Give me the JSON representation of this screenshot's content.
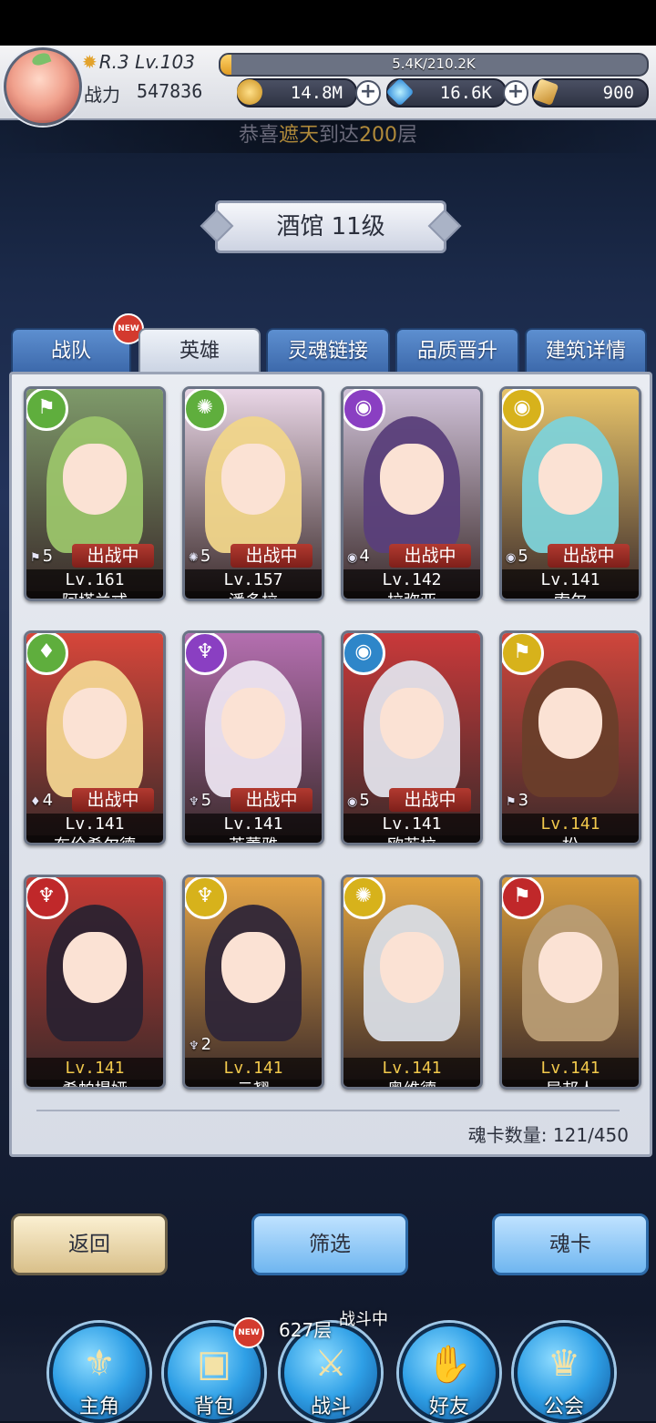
{
  "header": {
    "rank": "R.3 Lv.103",
    "exp_text": "5.4K/210.2K",
    "exp_fraction": 0.026,
    "power_label": "战力",
    "power_value": "547836",
    "gold": "14.8M",
    "diamond": "16.6K",
    "tickets": "900"
  },
  "announcement": {
    "prefix": "恭喜",
    "name": "遮天",
    "middle": "到达",
    "floor": "200",
    "suffix": "层"
  },
  "banner": {
    "title": "酒馆 11级"
  },
  "tabs": [
    {
      "label": "战队",
      "new": true,
      "new_label": "NEW"
    },
    {
      "label": "英雄",
      "active": true
    },
    {
      "label": "灵魂链接"
    },
    {
      "label": "品质晋升"
    },
    {
      "label": "建筑详情"
    }
  ],
  "heroes": [
    {
      "name": "阿塔兰忒",
      "level": "Lv.161",
      "stars": "5",
      "fighting": "出战中",
      "element": "flag",
      "icon": "flag-icon",
      "elem_color": "#5fae3d",
      "hair": "#9bc46a",
      "bg": "#7e9a6a"
    },
    {
      "name": "潘多拉",
      "level": "Lv.157",
      "stars": "5",
      "fighting": "出战中",
      "element": "swirl",
      "icon": "swirl-icon",
      "elem_color": "#5fae3d",
      "hair": "#f0d58a",
      "bg": "#e9d6e6"
    },
    {
      "name": "拉弥亚",
      "level": "Lv.142",
      "stars": "4",
      "fighting": "出战中",
      "element": "eye",
      "icon": "eye-icon",
      "elem_color": "#8a3fc2",
      "hair": "#5a3f7a",
      "bg": "#d0c2d8"
    },
    {
      "name": "索尔",
      "level": "Lv.141",
      "stars": "5",
      "fighting": "出战中",
      "element": "eye",
      "icon": "eye-icon",
      "elem_color": "#d7b21b",
      "hair": "#7ed2d8",
      "bg": "#e8c46a"
    },
    {
      "name": "布伦希尔德",
      "level": "Lv.141",
      "stars": "4",
      "fighting": "出战中",
      "element": "blade",
      "icon": "blade-icon",
      "elem_color": "#5fae3d",
      "hair": "#f2d490",
      "bg": "#d7463a"
    },
    {
      "name": "芙蕾雅",
      "level": "Lv.141",
      "stars": "5",
      "fighting": "出战中",
      "element": "wing",
      "icon": "wing-icon",
      "elem_color": "#8a3fc2",
      "hair": "#ece4f0",
      "bg": "#b46fb0"
    },
    {
      "name": "欧若拉",
      "level": "Lv.141",
      "stars": "5",
      "fighting": "出战中",
      "element": "eye",
      "icon": "eye-icon",
      "elem_color": "#2e86c9",
      "hair": "#e2e2ea",
      "bg": "#c9393a"
    },
    {
      "name": "松",
      "level": "Lv.141",
      "stars": "3",
      "fighting": "",
      "element": "flag",
      "icon": "flag-icon",
      "elem_color": "#d7b21b",
      "hair": "#6a3e2a",
      "bg": "#d0463c",
      "gold_level": true
    },
    {
      "name": "希帕提娅",
      "level": "Lv.141",
      "stars": "",
      "fighting": "",
      "element": "wing",
      "icon": "wing-icon",
      "elem_color": "#c0282a",
      "hair": "#2b2230",
      "bg": "#c43a34",
      "gold_level": true
    },
    {
      "name": "云翘",
      "level": "Lv.141",
      "stars": "2",
      "fighting": "",
      "element": "wing",
      "icon": "wing-icon",
      "elem_color": "#d7b21b",
      "hair": "#2f2638",
      "bg": "#e4a446",
      "gold_level": true
    },
    {
      "name": "奥维德",
      "level": "Lv.141",
      "stars": "",
      "fighting": "",
      "element": "swirl",
      "icon": "swirl-icon",
      "elem_color": "#d7b21b",
      "hair": "#d8dce4",
      "bg": "#e2a440",
      "gold_level": true
    },
    {
      "name": "异邦人",
      "level": "Lv.141",
      "stars": "",
      "fighting": "",
      "element": "flag",
      "icon": "flag-icon",
      "elem_color": "#c0282a",
      "hair": "#b89c74",
      "bg": "#d69a3a",
      "gold_level": true
    }
  ],
  "card_count_label": "魂卡数量",
  "card_count_value": "121/450",
  "buttons": {
    "back": "返回",
    "filter": "筛选",
    "soul_card": "魂卡"
  },
  "bottom_status": {
    "floor": "627层",
    "status": "战斗中"
  },
  "nav": [
    {
      "label": "主角",
      "icon": "helmet-icon",
      "glyph": "⚜"
    },
    {
      "label": "背包",
      "icon": "backpack-icon",
      "glyph": "▣",
      "new": true,
      "new_label": "NEW"
    },
    {
      "label": "战斗",
      "icon": "crossed-swords-icon",
      "glyph": "⚔"
    },
    {
      "label": "好友",
      "icon": "handshake-icon",
      "glyph": "✋"
    },
    {
      "label": "公会",
      "icon": "guild-crest-icon",
      "glyph": "♛"
    }
  ]
}
